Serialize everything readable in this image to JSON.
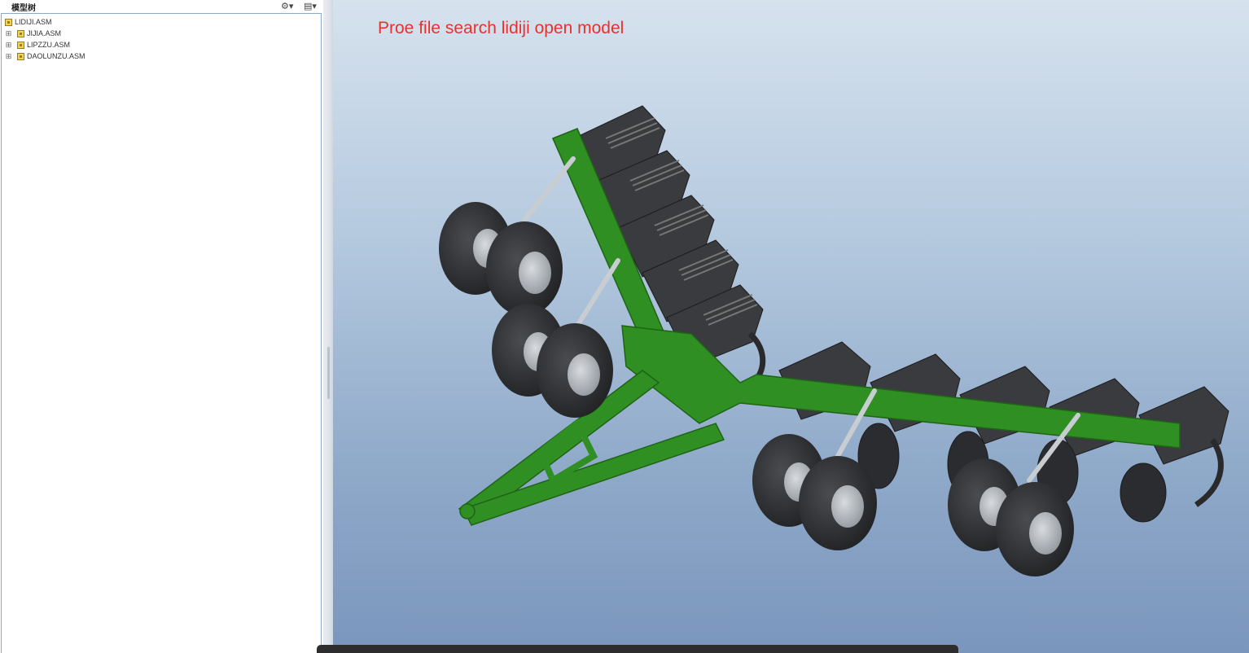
{
  "tree": {
    "title": "模型树",
    "nodes": [
      {
        "label": "LIDIJI.ASM",
        "level": 0,
        "expandable": false
      },
      {
        "label": "JIJIA.ASM",
        "level": 1,
        "expandable": true
      },
      {
        "label": "LIPZZU.ASM",
        "level": 1,
        "expandable": true
      },
      {
        "label": "DAOLUNZU.ASM",
        "level": 1,
        "expandable": true
      }
    ],
    "header_icons": [
      "tree-settings-icon",
      "show-filter-icon"
    ]
  },
  "viewport": {
    "caption": "Proe file search lidiji open model",
    "model_name": "LIDIJI.ASM"
  },
  "colors": {
    "frame_green": "#2f8f22",
    "caption_red": "#e8322b",
    "tire_dark": "#2a2b2d",
    "rim_gray": "#9aa0a6"
  }
}
